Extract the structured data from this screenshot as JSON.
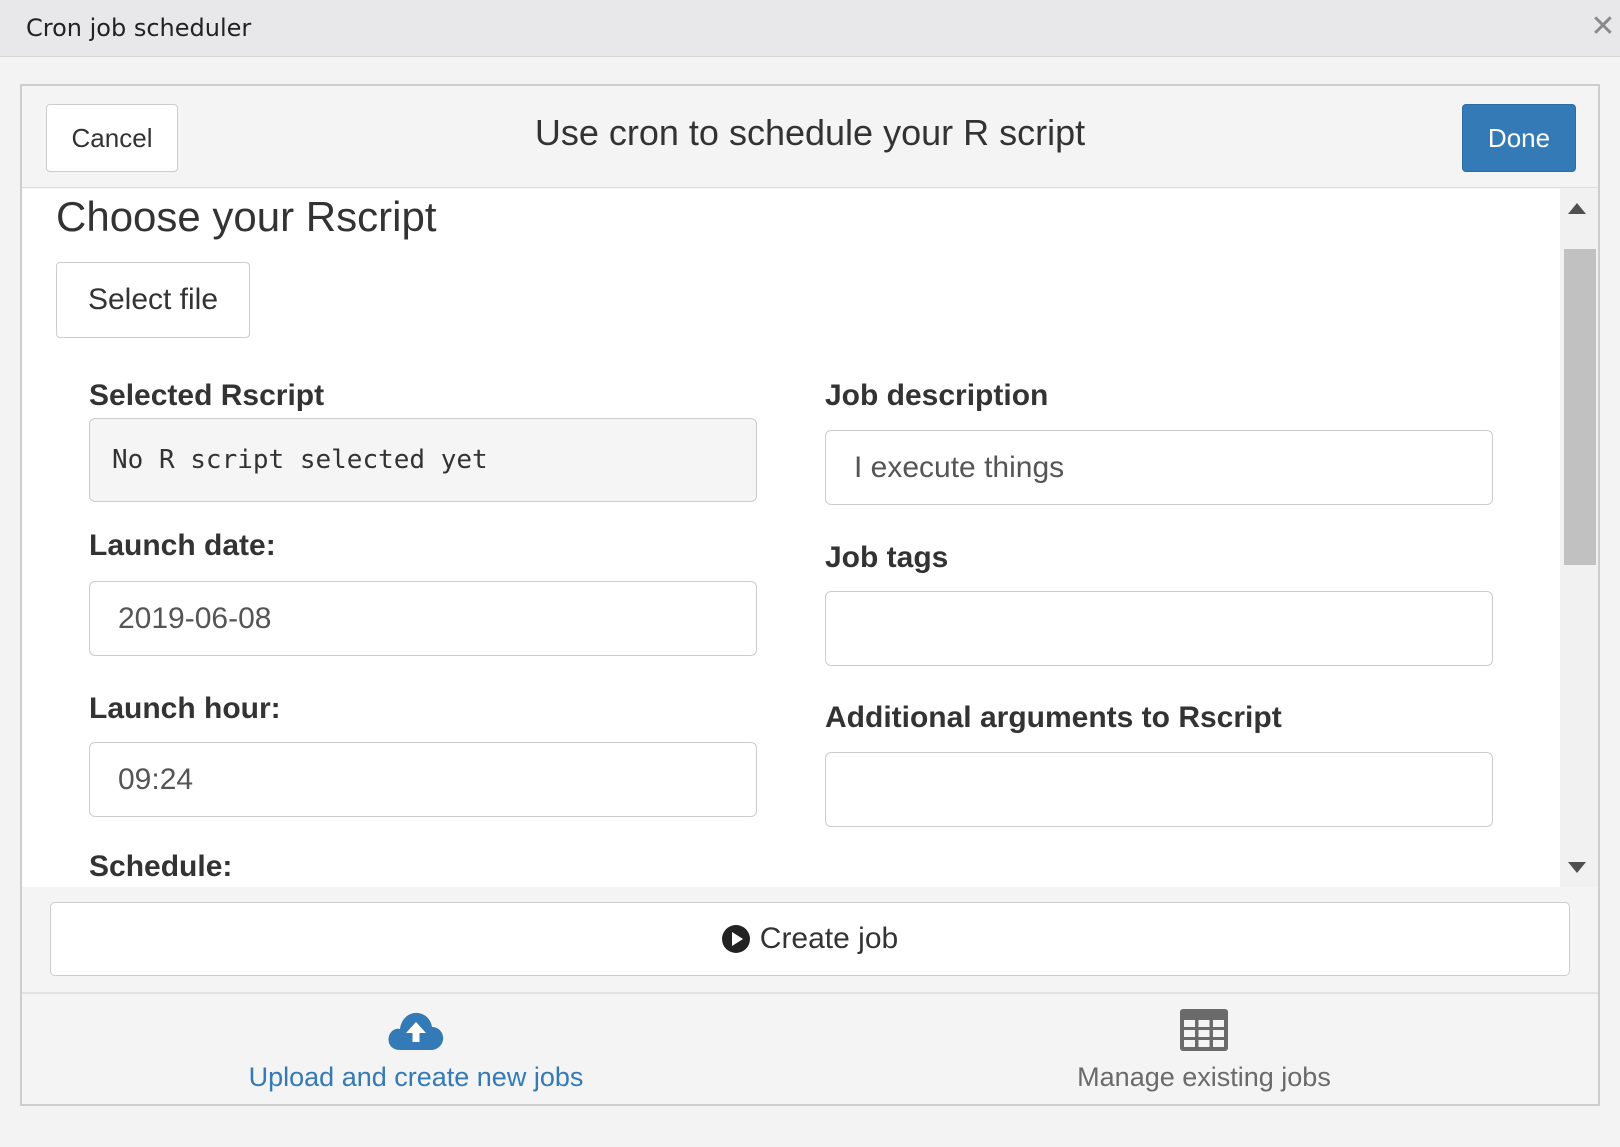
{
  "window": {
    "title": "Cron job scheduler",
    "close_glyph": "✕"
  },
  "header": {
    "cancel_label": "Cancel",
    "title": "Use cron to schedule your R script",
    "done_label": "Done"
  },
  "form": {
    "section_title": "Choose your Rscript",
    "select_file_label": "Select file",
    "selected_rscript": {
      "label": "Selected Rscript",
      "value": "No R script selected yet"
    },
    "launch_date": {
      "label": "Launch date:",
      "value": "2019-06-08"
    },
    "launch_hour": {
      "label": "Launch hour:",
      "value": "09:24"
    },
    "job_description": {
      "label": "Job description",
      "value": "I execute things"
    },
    "job_tags": {
      "label": "Job tags",
      "value": ""
    },
    "additional_arguments": {
      "label": "Additional arguments to Rscript",
      "value": ""
    },
    "schedule_label": "Schedule:"
  },
  "create_job_label": "Create job",
  "tabs": [
    {
      "label": "Upload and create new jobs",
      "icon": "cloud-upload-icon",
      "active": true
    },
    {
      "label": "Manage existing jobs",
      "icon": "table-icon",
      "active": false
    }
  ],
  "colors": {
    "primary": "#337ab7",
    "inactive_tab": "#6a6a6a"
  }
}
